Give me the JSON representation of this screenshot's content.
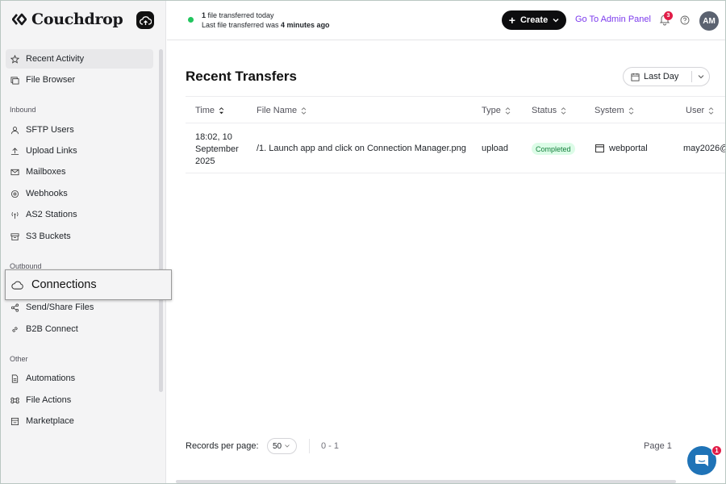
{
  "brand": {
    "name": "Couchdrop"
  },
  "header": {
    "status_count": "1",
    "status_line1_rest": " file transferred today",
    "status_line2_prefix": "Last file transferred was ",
    "status_line2_time": "4 minutes ago",
    "create_label": "Create",
    "admin_link": "Go To Admin Panel",
    "notifications_count": "3",
    "avatar_initials": "AM"
  },
  "sidebar": {
    "recent_activity": "Recent Activity",
    "file_browser": "File Browser",
    "inbound_label": "Inbound",
    "inbound": [
      "SFTP Users",
      "Upload Links",
      "Mailboxes",
      "Webhooks",
      "AS2 Stations",
      "S3 Buckets"
    ],
    "outbound_label": "Outbound",
    "outbound": [
      "Connections",
      "Send/Share Files",
      "B2B Connect"
    ],
    "other_label": "Other",
    "other": [
      "Automations",
      "File Actions",
      "Marketplace"
    ]
  },
  "main": {
    "title": "Recent Transfers",
    "range_select": "Last Day",
    "columns": [
      "Time",
      "File Name",
      "Type",
      "Status",
      "System",
      "User"
    ],
    "rows": [
      {
        "time": "18:02, 10 September 2025",
        "file_name": "/1. Launch app and click on Connection Manager.png",
        "type": "upload",
        "status": "Completed",
        "system": "webportal",
        "user": "may2026@"
      }
    ],
    "records_per_page_label": "Records per page:",
    "records_per_page": "50",
    "range_label": "0 - 1",
    "page_label": "Page 1"
  },
  "chat": {
    "unread": "1"
  },
  "colors": {
    "accent": "#7c3aed",
    "status_green": "#22c55e",
    "badge_red": "#e11d48",
    "chat_blue": "#1f73b7"
  }
}
